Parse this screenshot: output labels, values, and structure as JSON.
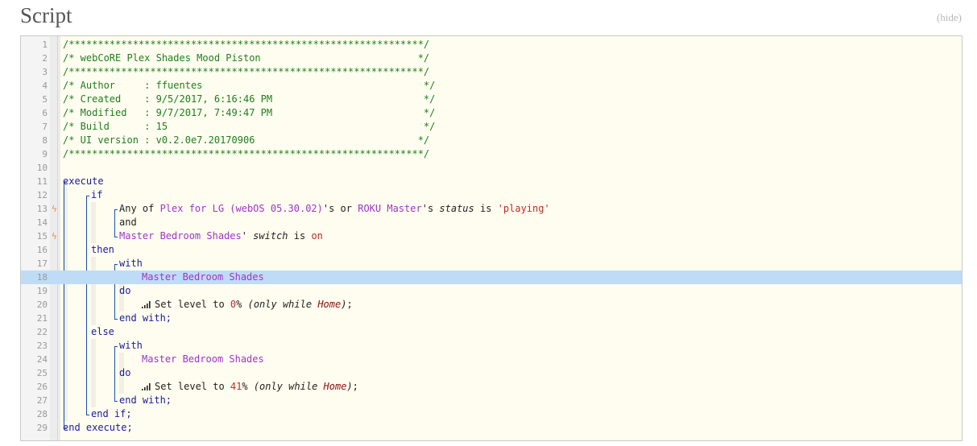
{
  "header": {
    "title": "Script",
    "hide_label": "(hide)"
  },
  "code": {
    "highlighted_line": 18,
    "lines": [
      {
        "n": "1",
        "indent": 0,
        "tokens": [
          {
            "t": "/*************************************************************/",
            "c": "c"
          }
        ]
      },
      {
        "n": "2",
        "indent": 0,
        "tokens": [
          {
            "t": "/* webCoRE Plex Shades Mood Piston                           */",
            "c": "c"
          }
        ]
      },
      {
        "n": "3",
        "indent": 0,
        "tokens": [
          {
            "t": "/*************************************************************/",
            "c": "c"
          }
        ]
      },
      {
        "n": "4",
        "indent": 0,
        "tokens": [
          {
            "t": "/* Author     : ffuentes                                      */",
            "c": "c"
          }
        ]
      },
      {
        "n": "5",
        "indent": 0,
        "tokens": [
          {
            "t": "/* Created    : 9/5/2017, 6:16:46 PM                          */",
            "c": "c"
          }
        ]
      },
      {
        "n": "6",
        "indent": 0,
        "tokens": [
          {
            "t": "/* Modified   : 9/7/2017, 7:49:47 PM                          */",
            "c": "c"
          }
        ]
      },
      {
        "n": "7",
        "indent": 0,
        "tokens": [
          {
            "t": "/* Build      : 15                                            */",
            "c": "c"
          }
        ]
      },
      {
        "n": "8",
        "indent": 0,
        "tokens": [
          {
            "t": "/* UI version : v0.2.0e7.20170906                            */",
            "c": "c"
          }
        ]
      },
      {
        "n": "9",
        "indent": 0,
        "tokens": [
          {
            "t": "/*************************************************************/",
            "c": "c"
          }
        ]
      },
      {
        "n": "10",
        "indent": 0,
        "tokens": []
      },
      {
        "n": "11",
        "indent": 0,
        "tokens": [
          {
            "t": "execute",
            "c": "kw"
          }
        ]
      },
      {
        "n": "12",
        "indent": 1,
        "tokens": [
          {
            "t": "if",
            "c": "kw"
          }
        ]
      },
      {
        "n": "13",
        "indent": 2,
        "bolt": true,
        "tokens": [
          {
            "t": "Any of ",
            "c": ""
          },
          {
            "t": "Plex for LG (webOS 05.30.02)",
            "c": "dev"
          },
          {
            "t": "'s or ",
            "c": ""
          },
          {
            "t": "ROKU Master",
            "c": "dev"
          },
          {
            "t": "'s ",
            "c": ""
          },
          {
            "t": "status",
            "c": "it"
          },
          {
            "t": " is ",
            "c": ""
          },
          {
            "t": "'playing'",
            "c": "str"
          }
        ]
      },
      {
        "n": "14",
        "indent": 2,
        "tokens": [
          {
            "t": "and",
            "c": ""
          }
        ]
      },
      {
        "n": "15",
        "indent": 2,
        "bolt": true,
        "tokens": [
          {
            "t": "Master Bedroom Shades",
            "c": "dev"
          },
          {
            "t": "' ",
            "c": ""
          },
          {
            "t": "switch",
            "c": "it"
          },
          {
            "t": " is ",
            "c": ""
          },
          {
            "t": "on",
            "c": "val"
          }
        ]
      },
      {
        "n": "16",
        "indent": 1,
        "tokens": [
          {
            "t": "then",
            "c": "kw"
          }
        ]
      },
      {
        "n": "17",
        "indent": 2,
        "tokens": [
          {
            "t": "with",
            "c": "kw"
          }
        ]
      },
      {
        "n": "18",
        "indent": 3,
        "tokens": [
          {
            "t": "Master Bedroom Shades",
            "c": "dev"
          }
        ]
      },
      {
        "n": "19",
        "indent": 2,
        "tokens": [
          {
            "t": "do",
            "c": "kw"
          }
        ]
      },
      {
        "n": "20",
        "indent": 3,
        "signal": true,
        "tokens": [
          {
            "t": "Set level to ",
            "c": ""
          },
          {
            "t": "0",
            "c": "val"
          },
          {
            "t": "% ",
            "c": ""
          },
          {
            "t": "(only while ",
            "c": "it"
          },
          {
            "t": "Home",
            "c": "var"
          },
          {
            "t": ")",
            "c": "it"
          },
          {
            "t": ";",
            "c": ""
          }
        ]
      },
      {
        "n": "21",
        "indent": 2,
        "tokens": [
          {
            "t": "end with;",
            "c": "kw"
          }
        ]
      },
      {
        "n": "22",
        "indent": 1,
        "tokens": [
          {
            "t": "else",
            "c": "kw"
          }
        ]
      },
      {
        "n": "23",
        "indent": 2,
        "tokens": [
          {
            "t": "with",
            "c": "kw"
          }
        ]
      },
      {
        "n": "24",
        "indent": 3,
        "tokens": [
          {
            "t": "Master Bedroom Shades",
            "c": "dev"
          }
        ]
      },
      {
        "n": "25",
        "indent": 2,
        "tokens": [
          {
            "t": "do",
            "c": "kw"
          }
        ]
      },
      {
        "n": "26",
        "indent": 3,
        "signal": true,
        "tokens": [
          {
            "t": "Set level to ",
            "c": ""
          },
          {
            "t": "41",
            "c": "val"
          },
          {
            "t": "% ",
            "c": ""
          },
          {
            "t": "(only while ",
            "c": "it"
          },
          {
            "t": "Home",
            "c": "var"
          },
          {
            "t": ")",
            "c": "it"
          },
          {
            "t": ";",
            "c": ""
          }
        ]
      },
      {
        "n": "27",
        "indent": 2,
        "tokens": [
          {
            "t": "end with;",
            "c": "kw"
          }
        ]
      },
      {
        "n": "28",
        "indent": 1,
        "tokens": [
          {
            "t": "end if;",
            "c": "kw"
          }
        ]
      },
      {
        "n": "29",
        "indent": 0,
        "tokens": [
          {
            "t": "end execute;",
            "c": "kw"
          }
        ]
      }
    ]
  }
}
